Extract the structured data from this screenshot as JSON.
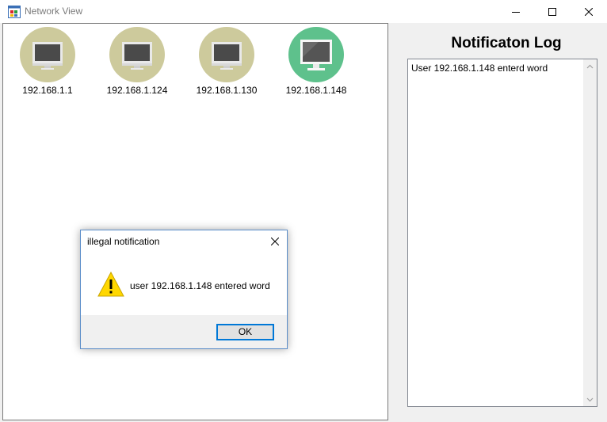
{
  "window": {
    "title": "Network View"
  },
  "icons": {
    "app": "app-window-icon",
    "minimize": "minimize-icon",
    "maximize": "maximize-icon",
    "close": "close-icon",
    "host": "monitor-icon",
    "warning": "warning-icon"
  },
  "colors": {
    "host_inactive": "#cdca9c",
    "host_active": "#5ec18c",
    "dialog_border": "#5b8dc9",
    "ok_border": "#0078d7"
  },
  "network": {
    "hosts": [
      {
        "label": "192.168.1.1",
        "active": false
      },
      {
        "label": "192.168.1.124",
        "active": false
      },
      {
        "label": "192.168.1.130",
        "active": false
      },
      {
        "label": "192.168.1.148",
        "active": true
      }
    ]
  },
  "log": {
    "title": "Notificaton Log",
    "entries": [
      "User 192.168.1.148 enterd word"
    ]
  },
  "dialog": {
    "title": "illegal notification",
    "message": "user 192.168.1.148 entered word",
    "ok_label": "OK"
  }
}
